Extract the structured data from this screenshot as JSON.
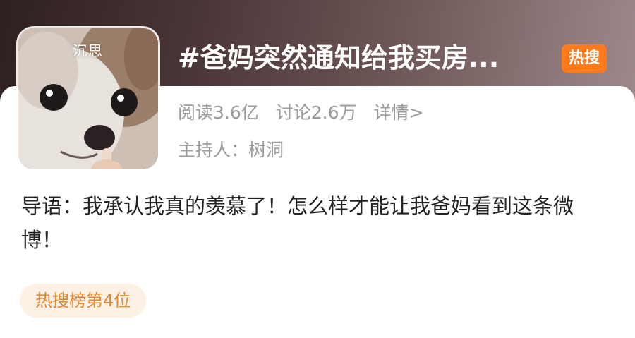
{
  "avatar": {
    "caption": "沉思"
  },
  "topic": {
    "title": "#爸妈突然通知给我买房...",
    "badge": "热搜",
    "badge_color": "#ff7a1a"
  },
  "stats": {
    "reads": "阅读3.6亿",
    "discussions": "讨论2.6万",
    "details_link": "详情>"
  },
  "host": {
    "text": "主持人：树洞"
  },
  "intro": {
    "text": "导语：我承认我真的羡慕了！怎么样才能让我爸妈看到这条微博！"
  },
  "rank": {
    "label": "热搜榜第4位",
    "color": "#e0862f"
  }
}
